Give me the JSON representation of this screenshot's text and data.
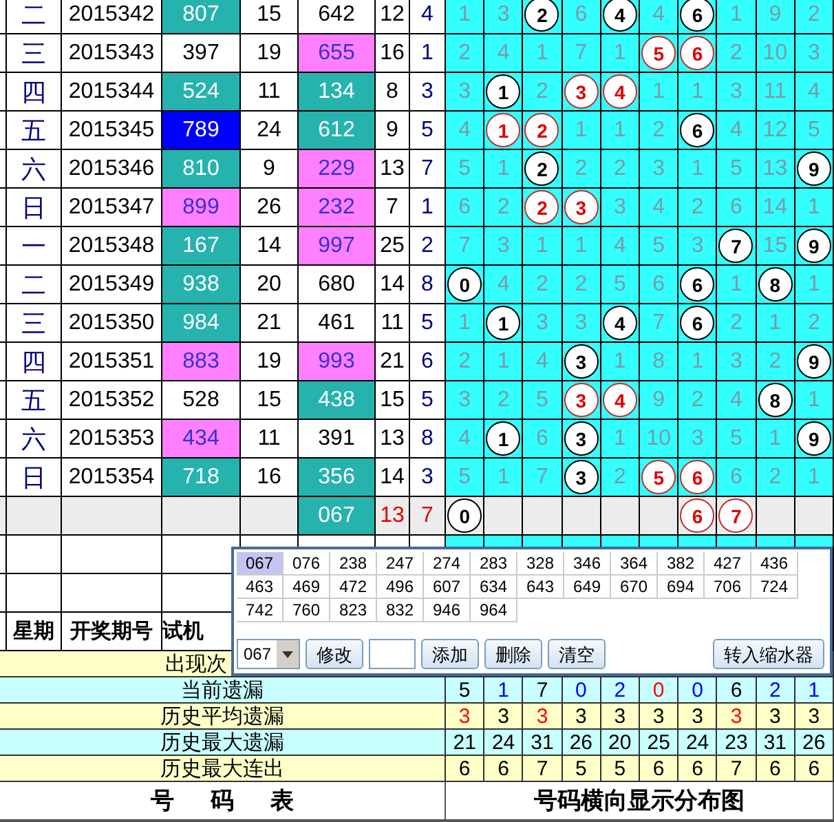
{
  "draws": [
    {
      "weekday": "二",
      "period": "2015342",
      "test_number": {
        "text": "807",
        "color": "#26b3ae"
      },
      "sum": "15",
      "number": {
        "text": "642",
        "color": "#ffffff"
      },
      "col_6": "12",
      "col_7": "4",
      "cells": [
        {
          "kind": "miss",
          "text": "1"
        },
        {
          "kind": "miss",
          "text": "3"
        },
        {
          "kind": "ball",
          "text": "2"
        },
        {
          "kind": "miss",
          "text": "6"
        },
        {
          "kind": "ball",
          "text": "4"
        },
        {
          "kind": "miss",
          "text": "4"
        },
        {
          "kind": "ball",
          "text": "6"
        },
        {
          "kind": "miss",
          "text": "1"
        },
        {
          "kind": "miss",
          "text": "9"
        },
        {
          "kind": "miss",
          "text": "2"
        }
      ]
    },
    {
      "weekday": "三",
      "period": "2015343",
      "test_number": {
        "text": "397",
        "color": "#ffffff"
      },
      "sum": "19",
      "number": {
        "text": "655",
        "color": "#ff80ff"
      },
      "col_6": "16",
      "col_7": "1",
      "cells": [
        {
          "kind": "miss",
          "text": "2"
        },
        {
          "kind": "miss",
          "text": "4"
        },
        {
          "kind": "miss",
          "text": "1"
        },
        {
          "kind": "miss",
          "text": "7"
        },
        {
          "kind": "miss",
          "text": "1"
        },
        {
          "kind": "red-ball",
          "text": "5"
        },
        {
          "kind": "red-ball",
          "text": "6"
        },
        {
          "kind": "miss",
          "text": "2"
        },
        {
          "kind": "miss",
          "text": "10"
        },
        {
          "kind": "miss",
          "text": "3"
        }
      ]
    },
    {
      "weekday": "四",
      "period": "2015344",
      "test_number": {
        "text": "524",
        "color": "#26b3ae"
      },
      "sum": "11",
      "number": {
        "text": "134",
        "color": "#26b3ae"
      },
      "col_6": "8",
      "col_7": "3",
      "cells": [
        {
          "kind": "miss",
          "text": "3"
        },
        {
          "kind": "ball",
          "text": "1"
        },
        {
          "kind": "miss",
          "text": "2"
        },
        {
          "kind": "red-ball",
          "text": "3"
        },
        {
          "kind": "red-ball",
          "text": "4"
        },
        {
          "kind": "miss",
          "text": "1"
        },
        {
          "kind": "miss",
          "text": "1"
        },
        {
          "kind": "miss",
          "text": "3"
        },
        {
          "kind": "miss",
          "text": "11"
        },
        {
          "kind": "miss",
          "text": "4"
        }
      ]
    },
    {
      "weekday": "五",
      "period": "2015345",
      "test_number": {
        "text": "789",
        "color": "#0000ff"
      },
      "sum": "24",
      "number": {
        "text": "612",
        "color": "#26b3ae"
      },
      "col_6": "9",
      "col_7": "5",
      "cells": [
        {
          "kind": "miss",
          "text": "4"
        },
        {
          "kind": "red-ball",
          "text": "1"
        },
        {
          "kind": "red-ball",
          "text": "2"
        },
        {
          "kind": "miss",
          "text": "1"
        },
        {
          "kind": "miss",
          "text": "1"
        },
        {
          "kind": "miss",
          "text": "2"
        },
        {
          "kind": "ball",
          "text": "6"
        },
        {
          "kind": "miss",
          "text": "4"
        },
        {
          "kind": "miss",
          "text": "12"
        },
        {
          "kind": "miss",
          "text": "5"
        }
      ]
    },
    {
      "weekday": "六",
      "period": "2015346",
      "test_number": {
        "text": "810",
        "color": "#26b3ae"
      },
      "sum": "9",
      "number": {
        "text": "229",
        "color": "#ff80ff"
      },
      "col_6": "13",
      "col_7": "7",
      "cells": [
        {
          "kind": "miss",
          "text": "5"
        },
        {
          "kind": "miss",
          "text": "1"
        },
        {
          "kind": "ball",
          "text": "2"
        },
        {
          "kind": "miss",
          "text": "2"
        },
        {
          "kind": "miss",
          "text": "2"
        },
        {
          "kind": "miss",
          "text": "3"
        },
        {
          "kind": "miss",
          "text": "1"
        },
        {
          "kind": "miss",
          "text": "5"
        },
        {
          "kind": "miss",
          "text": "13"
        },
        {
          "kind": "ball",
          "text": "9"
        }
      ]
    },
    {
      "weekday": "日",
      "period": "2015347",
      "test_number": {
        "text": "899",
        "color": "#ff80ff"
      },
      "sum": "26",
      "number": {
        "text": "232",
        "color": "#ff80ff"
      },
      "col_6": "7",
      "col_7": "1",
      "cells": [
        {
          "kind": "miss",
          "text": "6"
        },
        {
          "kind": "miss",
          "text": "2"
        },
        {
          "kind": "red-ball",
          "text": "2"
        },
        {
          "kind": "red-ball",
          "text": "3"
        },
        {
          "kind": "miss",
          "text": "3"
        },
        {
          "kind": "miss",
          "text": "4"
        },
        {
          "kind": "miss",
          "text": "2"
        },
        {
          "kind": "miss",
          "text": "6"
        },
        {
          "kind": "miss",
          "text": "14"
        },
        {
          "kind": "miss",
          "text": "1"
        }
      ]
    },
    {
      "weekday": "一",
      "period": "2015348",
      "test_number": {
        "text": "167",
        "color": "#26b3ae"
      },
      "sum": "14",
      "number": {
        "text": "997",
        "color": "#ff80ff"
      },
      "col_6": "25",
      "col_7": "2",
      "cells": [
        {
          "kind": "miss",
          "text": "7"
        },
        {
          "kind": "miss",
          "text": "3"
        },
        {
          "kind": "miss",
          "text": "1"
        },
        {
          "kind": "miss",
          "text": "1"
        },
        {
          "kind": "miss",
          "text": "4"
        },
        {
          "kind": "miss",
          "text": "5"
        },
        {
          "kind": "miss",
          "text": "3"
        },
        {
          "kind": "ball",
          "text": "7"
        },
        {
          "kind": "miss",
          "text": "15"
        },
        {
          "kind": "ball",
          "text": "9"
        }
      ]
    },
    {
      "weekday": "二",
      "period": "2015349",
      "test_number": {
        "text": "938",
        "color": "#26b3ae"
      },
      "sum": "20",
      "number": {
        "text": "680",
        "color": "#ffffff"
      },
      "col_6": "14",
      "col_7": "8",
      "cells": [
        {
          "kind": "ball",
          "text": "0"
        },
        {
          "kind": "miss",
          "text": "4"
        },
        {
          "kind": "miss",
          "text": "2"
        },
        {
          "kind": "miss",
          "text": "2"
        },
        {
          "kind": "miss",
          "text": "5"
        },
        {
          "kind": "miss",
          "text": "6"
        },
        {
          "kind": "ball",
          "text": "6"
        },
        {
          "kind": "miss",
          "text": "1"
        },
        {
          "kind": "ball",
          "text": "8"
        },
        {
          "kind": "miss",
          "text": "1"
        }
      ]
    },
    {
      "weekday": "三",
      "period": "2015350",
      "test_number": {
        "text": "984",
        "color": "#26b3ae"
      },
      "sum": "21",
      "number": {
        "text": "461",
        "color": "#ffffff"
      },
      "col_6": "11",
      "col_7": "5",
      "cells": [
        {
          "kind": "miss",
          "text": "1"
        },
        {
          "kind": "ball",
          "text": "1"
        },
        {
          "kind": "miss",
          "text": "3"
        },
        {
          "kind": "miss",
          "text": "3"
        },
        {
          "kind": "ball",
          "text": "4"
        },
        {
          "kind": "miss",
          "text": "7"
        },
        {
          "kind": "ball",
          "text": "6"
        },
        {
          "kind": "miss",
          "text": "2"
        },
        {
          "kind": "miss",
          "text": "1"
        },
        {
          "kind": "miss",
          "text": "2"
        }
      ]
    },
    {
      "weekday": "四",
      "period": "2015351",
      "test_number": {
        "text": "883",
        "color": "#ff80ff"
      },
      "sum": "19",
      "number": {
        "text": "993",
        "color": "#ff80ff"
      },
      "col_6": "21",
      "col_7": "6",
      "cells": [
        {
          "kind": "miss",
          "text": "2"
        },
        {
          "kind": "miss",
          "text": "1"
        },
        {
          "kind": "miss",
          "text": "4"
        },
        {
          "kind": "ball",
          "text": "3"
        },
        {
          "kind": "miss",
          "text": "1"
        },
        {
          "kind": "miss",
          "text": "8"
        },
        {
          "kind": "miss",
          "text": "1"
        },
        {
          "kind": "miss",
          "text": "3"
        },
        {
          "kind": "miss",
          "text": "2"
        },
        {
          "kind": "ball",
          "text": "9"
        }
      ]
    },
    {
      "weekday": "五",
      "period": "2015352",
      "test_number": {
        "text": "528",
        "color": "#ffffff"
      },
      "sum": "15",
      "number": {
        "text": "438",
        "color": "#26b3ae"
      },
      "col_6": "15",
      "col_7": "5",
      "cells": [
        {
          "kind": "miss",
          "text": "3"
        },
        {
          "kind": "miss",
          "text": "2"
        },
        {
          "kind": "miss",
          "text": "5"
        },
        {
          "kind": "red-ball",
          "text": "3"
        },
        {
          "kind": "red-ball",
          "text": "4"
        },
        {
          "kind": "miss",
          "text": "9"
        },
        {
          "kind": "miss",
          "text": "2"
        },
        {
          "kind": "miss",
          "text": "4"
        },
        {
          "kind": "ball",
          "text": "8"
        },
        {
          "kind": "miss",
          "text": "1"
        }
      ]
    },
    {
      "weekday": "六",
      "period": "2015353",
      "test_number": {
        "text": "434",
        "color": "#ff80ff"
      },
      "sum": "11",
      "number": {
        "text": "391",
        "color": "#ffffff"
      },
      "col_6": "13",
      "col_7": "8",
      "cells": [
        {
          "kind": "miss",
          "text": "4"
        },
        {
          "kind": "ball",
          "text": "1"
        },
        {
          "kind": "miss",
          "text": "6"
        },
        {
          "kind": "ball",
          "text": "3"
        },
        {
          "kind": "miss",
          "text": "1"
        },
        {
          "kind": "miss",
          "text": "10"
        },
        {
          "kind": "miss",
          "text": "3"
        },
        {
          "kind": "miss",
          "text": "5"
        },
        {
          "kind": "miss",
          "text": "1"
        },
        {
          "kind": "ball",
          "text": "9"
        }
      ]
    },
    {
      "weekday": "日",
      "period": "2015354",
      "test_number": {
        "text": "718",
        "color": "#26b3ae"
      },
      "sum": "16",
      "number": {
        "text": "356",
        "color": "#26b3ae"
      },
      "col_6": "14",
      "col_7": "3",
      "cells": [
        {
          "kind": "miss",
          "text": "5"
        },
        {
          "kind": "miss",
          "text": "1"
        },
        {
          "kind": "miss",
          "text": "7"
        },
        {
          "kind": "ball",
          "text": "3"
        },
        {
          "kind": "miss",
          "text": "2"
        },
        {
          "kind": "red-ball",
          "text": "5"
        },
        {
          "kind": "red-ball",
          "text": "6"
        },
        {
          "kind": "miss",
          "text": "6"
        },
        {
          "kind": "miss",
          "text": "2"
        },
        {
          "kind": "miss",
          "text": "1"
        }
      ]
    }
  ],
  "summary": {
    "number": {
      "text": "067",
      "color": "#26b3ae"
    },
    "col_6": "13",
    "col_7": "7",
    "cells": [
      {
        "kind": "ball",
        "text": "0"
      },
      {
        "kind": "empty"
      },
      {
        "kind": "empty"
      },
      {
        "kind": "empty"
      },
      {
        "kind": "empty"
      },
      {
        "kind": "empty"
      },
      {
        "kind": "red-ball",
        "text": "6"
      },
      {
        "kind": "red-ball",
        "text": "7"
      },
      {
        "kind": "empty"
      },
      {
        "kind": "empty"
      }
    ]
  },
  "header": [
    "星期",
    "开奖期号",
    "试机"
  ],
  "stats": [
    {
      "label": "出现次"
    },
    {
      "label": "当前遗漏",
      "values": [
        {
          "text": "5",
          "color": "#000000"
        },
        {
          "text": "1",
          "color": "#0000ff"
        },
        {
          "text": "7",
          "color": "#000000"
        },
        {
          "text": "0",
          "color": "#0000ff"
        },
        {
          "text": "2",
          "color": "#0000ff"
        },
        {
          "text": "0",
          "color": "#ff0000"
        },
        {
          "text": "0",
          "color": "#0000ff"
        },
        {
          "text": "6",
          "color": "#000000"
        },
        {
          "text": "2",
          "color": "#0000ff"
        },
        {
          "text": "1",
          "color": "#0000ff"
        }
      ]
    },
    {
      "label": "历史平均遗漏",
      "values": [
        {
          "text": "3",
          "color": "#ff0000"
        },
        {
          "text": "3",
          "color": "#000000"
        },
        {
          "text": "3",
          "color": "#ff0000"
        },
        {
          "text": "3",
          "color": "#000000"
        },
        {
          "text": "3",
          "color": "#000000"
        },
        {
          "text": "3",
          "color": "#000000"
        },
        {
          "text": "3",
          "color": "#000000"
        },
        {
          "text": "3",
          "color": "#ff0000"
        },
        {
          "text": "3",
          "color": "#000000"
        },
        {
          "text": "3",
          "color": "#000000"
        }
      ]
    },
    {
      "label": "历史最大遗漏",
      "values": [
        {
          "text": "21",
          "color": "#000000"
        },
        {
          "text": "24",
          "color": "#000000"
        },
        {
          "text": "31",
          "color": "#000000"
        },
        {
          "text": "26",
          "color": "#000000"
        },
        {
          "text": "20",
          "color": "#000000"
        },
        {
          "text": "25",
          "color": "#000000"
        },
        {
          "text": "24",
          "color": "#000000"
        },
        {
          "text": "23",
          "color": "#000000"
        },
        {
          "text": "31",
          "color": "#000000"
        },
        {
          "text": "26",
          "color": "#000000"
        }
      ]
    },
    {
      "label": "历史最大连出",
      "values": [
        {
          "text": "6",
          "color": "#000000"
        },
        {
          "text": "6",
          "color": "#000000"
        },
        {
          "text": "7",
          "color": "#000000"
        },
        {
          "text": "5",
          "color": "#000000"
        },
        {
          "text": "5",
          "color": "#000000"
        },
        {
          "text": "6",
          "color": "#000000"
        },
        {
          "text": "6",
          "color": "#000000"
        },
        {
          "text": "7",
          "color": "#000000"
        },
        {
          "text": "6",
          "color": "#000000"
        },
        {
          "text": "6",
          "color": "#000000"
        }
      ]
    }
  ],
  "footer": {
    "left": "号 码 表",
    "right": "号码横向显示分布图"
  },
  "popup": {
    "numbers": [
      {
        "text": "067",
        "selected": true
      },
      {
        "text": "076",
        "selected": false
      },
      {
        "text": "238",
        "selected": false
      },
      {
        "text": "247",
        "selected": false
      },
      {
        "text": "274",
        "selected": false
      },
      {
        "text": "283",
        "selected": false
      },
      {
        "text": "328",
        "selected": false
      },
      {
        "text": "346",
        "selected": false
      },
      {
        "text": "364",
        "selected": false
      },
      {
        "text": "382",
        "selected": false
      },
      {
        "text": "427",
        "selected": false
      },
      {
        "text": "436",
        "selected": false
      },
      {
        "text": "463",
        "selected": false
      },
      {
        "text": "469",
        "selected": false
      },
      {
        "text": "472",
        "selected": false
      },
      {
        "text": "496",
        "selected": false
      },
      {
        "text": "607",
        "selected": false
      },
      {
        "text": "634",
        "selected": false
      },
      {
        "text": "643",
        "selected": false
      },
      {
        "text": "649",
        "selected": false
      },
      {
        "text": "670",
        "selected": false
      },
      {
        "text": "694",
        "selected": false
      },
      {
        "text": "706",
        "selected": false
      },
      {
        "text": "724",
        "selected": false
      },
      {
        "text": "742",
        "selected": false
      },
      {
        "text": "760",
        "selected": false
      },
      {
        "text": "823",
        "selected": false
      },
      {
        "text": "832",
        "selected": false
      },
      {
        "text": "946",
        "selected": false
      },
      {
        "text": "964",
        "selected": false
      }
    ],
    "select_value": "067",
    "edit_button": "修改",
    "add_button": "添加",
    "delete_button": "删除",
    "clear_button": "清空",
    "transfer_button": "转入缩水器"
  }
}
